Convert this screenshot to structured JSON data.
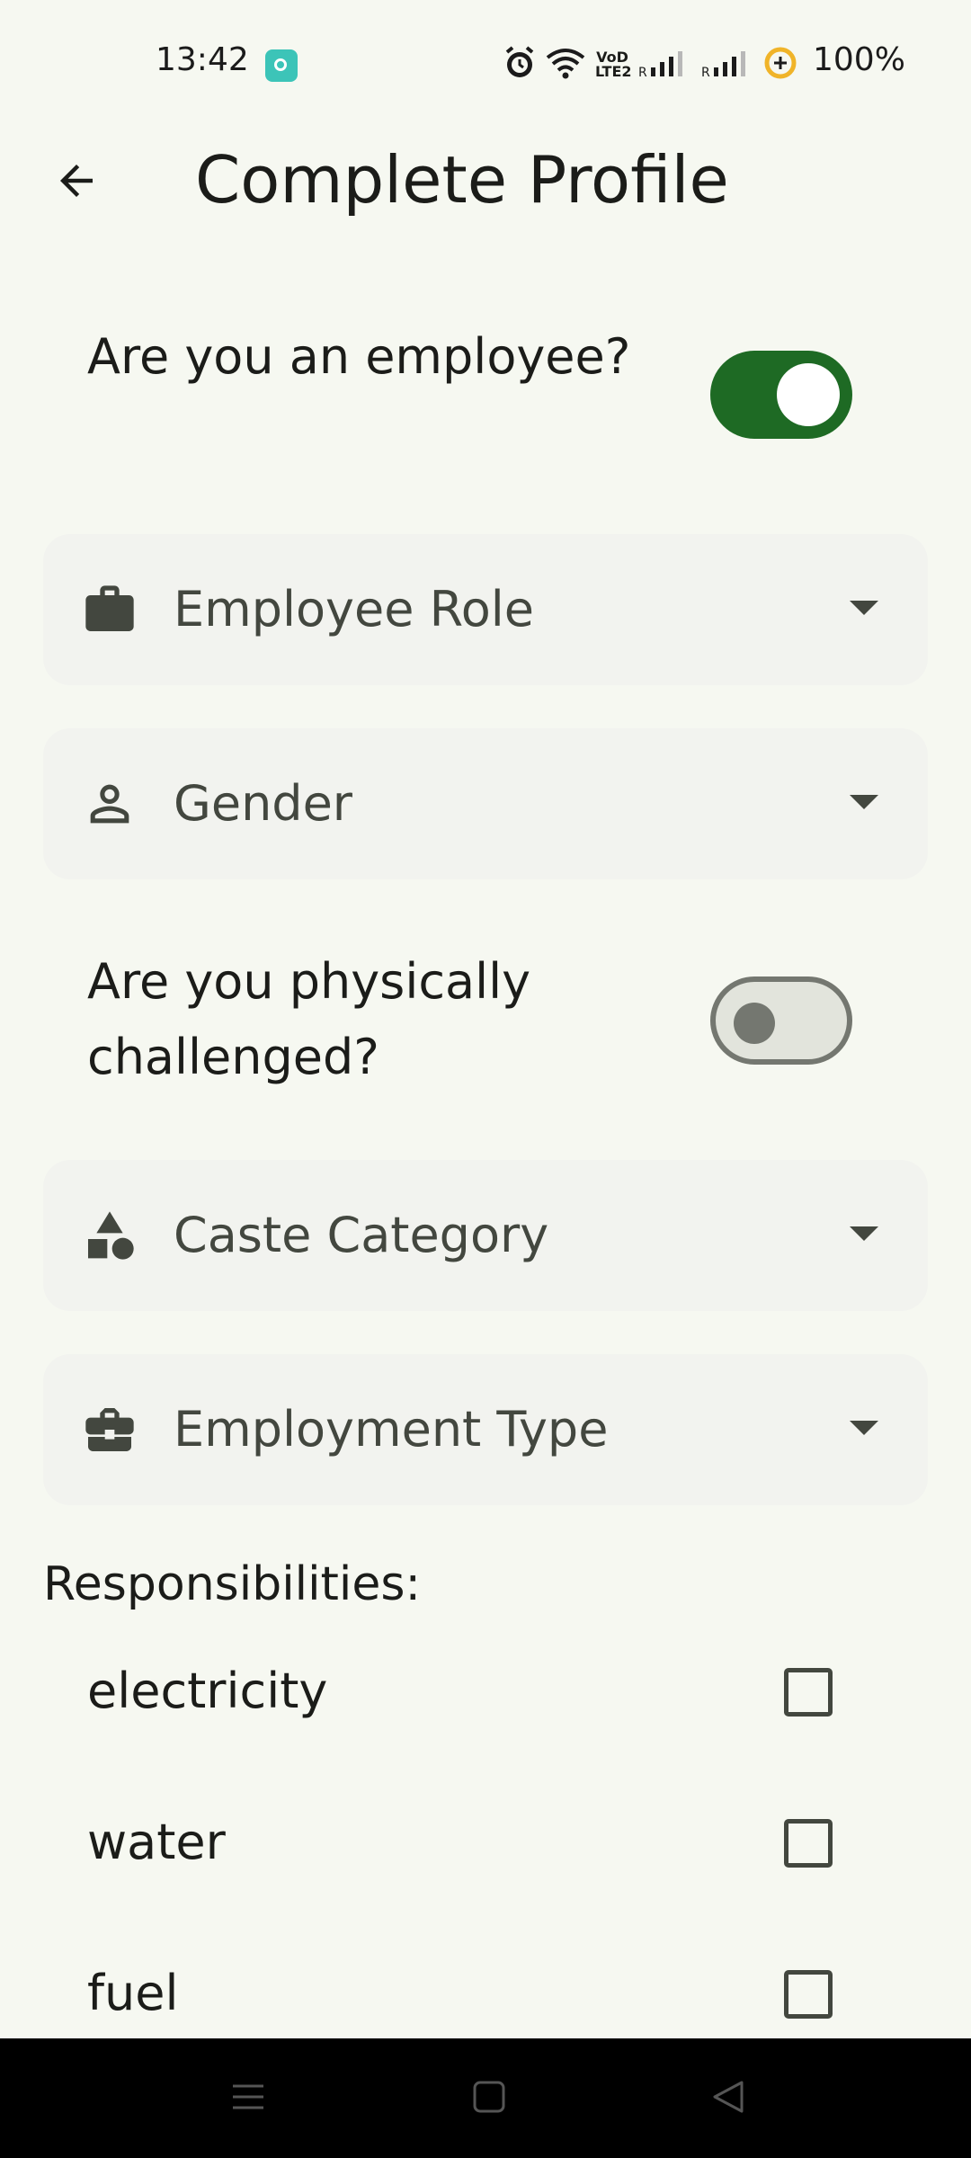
{
  "status_bar": {
    "time": "13:42",
    "app_icon": "focus-app-icon",
    "icons": [
      "alarm-icon",
      "wifi-icon",
      "volte-icon",
      "signal-icon",
      "signal-icon",
      "battery-saver-icon"
    ],
    "volte_text": "VoD LTE2",
    "battery": "100%"
  },
  "header": {
    "back_icon": "arrow-left-icon",
    "title": "Complete Profile"
  },
  "form": {
    "employee_toggle": {
      "label": "Are you an employee?",
      "checked": true
    },
    "employee_role": {
      "label": "Employee Role",
      "icon": "briefcase-icon"
    },
    "gender": {
      "label": "Gender",
      "icon": "person-icon"
    },
    "physically_challenged_toggle": {
      "label": "Are you physically challenged?",
      "checked": false
    },
    "caste_category": {
      "label": "Caste Category",
      "icon": "shapes-icon"
    },
    "employment_type": {
      "label": "Employment Type",
      "icon": "work-case-icon"
    }
  },
  "responsibilities": {
    "heading": "Responsibilities:",
    "items": [
      {
        "label": "electricity",
        "checked": false
      },
      {
        "label": "water",
        "checked": false
      },
      {
        "label": "fuel",
        "checked": false
      }
    ]
  },
  "nav_bar": {
    "buttons": [
      "menu-icon",
      "home-icon",
      "back-triangle-icon"
    ]
  },
  "colors": {
    "background": "#f6f8f1",
    "accent": "#1e6a24",
    "field_bg": "#f2f3ef",
    "icon": "#43473f"
  }
}
